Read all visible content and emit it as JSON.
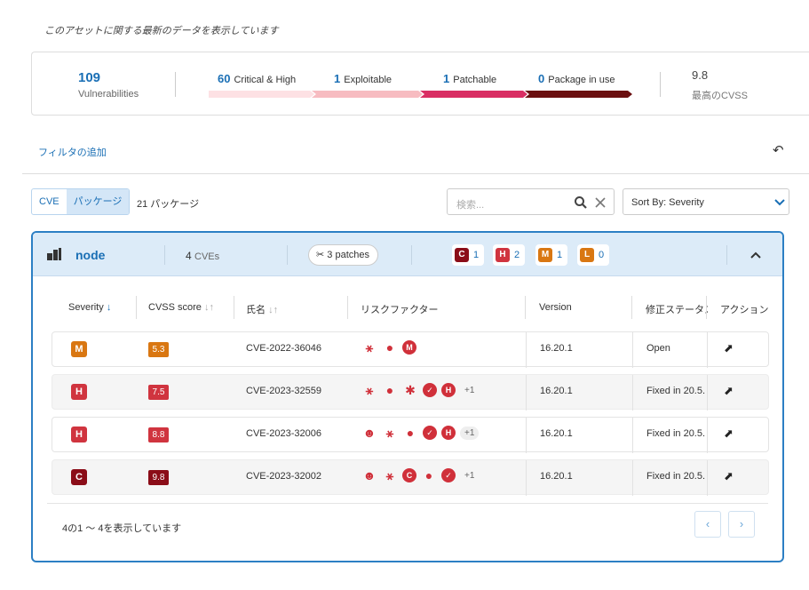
{
  "notice": "このアセットに関する最新のデータを表示しています",
  "summary": {
    "vulnerabilities_count": "109",
    "vulnerabilities_label": "Vulnerabilities",
    "funnel": [
      {
        "count": "60",
        "label": "Critical & High",
        "color": "#fde1e4"
      },
      {
        "count": "1",
        "label": "Exploitable",
        "color": "#f7bcc1"
      },
      {
        "count": "1",
        "label": "Patchable",
        "color": "#d92e63"
      },
      {
        "count": "0",
        "label": "Package in use",
        "color": "#6b0f10"
      }
    ],
    "max_cvss": "9.8",
    "max_cvss_label": "最高のCVSS"
  },
  "filter": {
    "add_filter": "フィルタの追加",
    "reset_icon": "undo-icon"
  },
  "view_toggle": {
    "cve": "CVE",
    "package": "パッケージ",
    "active": "package"
  },
  "package_count": "21 パッケージ",
  "search": {
    "placeholder": "検索..."
  },
  "sort": {
    "label": "Sort By: Severity"
  },
  "package": {
    "name": "node",
    "cve_count": "4",
    "cve_unit": "CVEs",
    "patches": "3 patches",
    "severity_counts": [
      {
        "letter": "C",
        "count": "1",
        "color": "#8b0d18"
      },
      {
        "letter": "H",
        "count": "2",
        "color": "#d0343f"
      },
      {
        "letter": "M",
        "count": "1",
        "color": "#d97712"
      },
      {
        "letter": "L",
        "count": "0",
        "color": "#d97712"
      }
    ]
  },
  "table": {
    "headers": {
      "severity": "Severity",
      "cvss": "CVSS score",
      "name": "氏名",
      "risk": "リスクファクター",
      "version": "Version",
      "fix": "修正ステータス",
      "action": "アクション"
    },
    "rows": [
      {
        "sev": "M",
        "sev_color": "#d97712",
        "score": "5.3",
        "score_color": "#d97712",
        "cve": "CVE-2022-36046",
        "risk_icons": [
          "network-icon",
          "exploit-bomb-icon",
          "M"
        ],
        "more": "",
        "version": "16.20.1",
        "fix": "Open"
      },
      {
        "sev": "H",
        "sev_color": "#d0343f",
        "score": "7.5",
        "score_color": "#d0343f",
        "cve": "CVE-2023-32559",
        "risk_icons": [
          "network-icon",
          "exploit-bomb-icon",
          "bug-icon",
          "check-icon",
          "H"
        ],
        "more": "+1",
        "version": "16.20.1",
        "fix": "Fixed in 20.5."
      },
      {
        "sev": "H",
        "sev_color": "#d0343f",
        "score": "8.8",
        "score_color": "#d0343f",
        "cve": "CVE-2023-32006",
        "risk_icons": [
          "alien-icon",
          "network-icon",
          "exploit-bomb-icon",
          "check-icon",
          "H"
        ],
        "more": "+1",
        "version": "16.20.1",
        "fix": "Fixed in 20.5."
      },
      {
        "sev": "C",
        "sev_color": "#8b0d18",
        "score": "9.8",
        "score_color": "#8b0d18",
        "cve": "CVE-2023-32002",
        "risk_icons": [
          "alien-icon",
          "network-icon",
          "C",
          "exploit-bomb-icon",
          "check-icon"
        ],
        "more": "+1",
        "version": "16.20.1",
        "fix": "Fixed in 20.5."
      }
    ]
  },
  "paging": {
    "text": "4の1 ～ 4を表示しています"
  }
}
